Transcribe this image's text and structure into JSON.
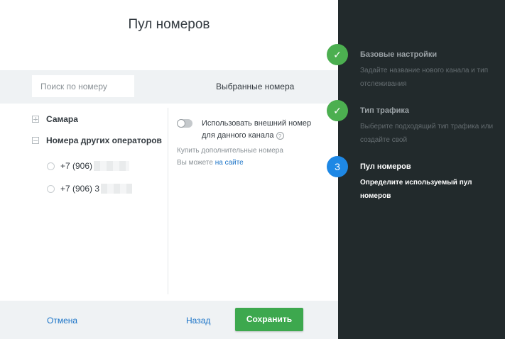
{
  "title": "Пул номеров",
  "search": {
    "placeholder": "Поиск по номеру"
  },
  "selected_label": "Выбранные номера",
  "tree": {
    "group1": "Самара",
    "group2": "Номера других операторов",
    "numbers": [
      "+7 (906) ",
      "+7 (906) 3"
    ]
  },
  "external": {
    "toggle_text": "Использовать внешний номер для данного канала",
    "help_icon": "?",
    "buy_text": "Купить дополнительные номера",
    "can_text": "Вы можете",
    "site_link": "на сайте"
  },
  "footer": {
    "cancel": "Отмена",
    "back": "Назад",
    "save": "Сохранить"
  },
  "steps": [
    {
      "marker": "✓",
      "title": "Базовые настройки",
      "desc": "Задайте название нового канала и тип отслеживания",
      "state": "done"
    },
    {
      "marker": "✓",
      "title": "Тип трафика",
      "desc": "Выберите подходящий тип трафика или создайте свой",
      "state": "done"
    },
    {
      "marker": "3",
      "title": "Пул номеров",
      "desc": "Определите используемый пул номеров",
      "state": "active"
    }
  ],
  "colors": {
    "accent_green": "#3da84e",
    "step_done": "#4caf50",
    "step_active": "#1e88e5",
    "link": "#1a73c7",
    "sidebar_bg": "#222a2c"
  }
}
